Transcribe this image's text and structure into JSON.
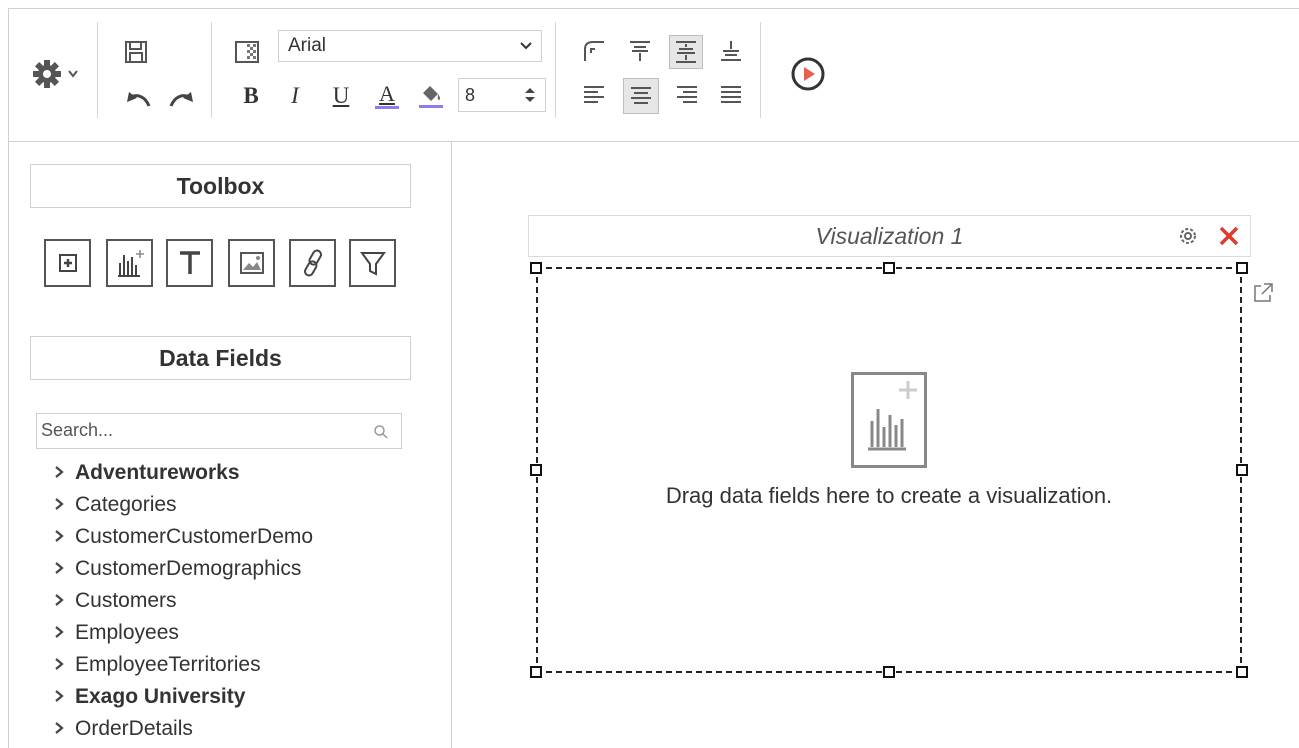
{
  "toolbar": {
    "settings_icon": "gear-dropdown-icon",
    "font_family": "Arial",
    "font_size": "8",
    "bold_label": "B",
    "italic_label": "I",
    "underline_label": "U",
    "font_color_label": "A",
    "font_color_accent": "#8a7ee8",
    "fill_color_accent": "#8a7ee8",
    "run_accent": "#e8604c"
  },
  "toolbox": {
    "title": "Toolbox",
    "tools": [
      "add-cell-icon",
      "chart-icon",
      "text-icon",
      "image-icon",
      "link-icon",
      "filter-icon"
    ]
  },
  "data_fields": {
    "title": "Data Fields",
    "search_placeholder": "Search...",
    "items": [
      {
        "label": "Adventureworks",
        "bold": true
      },
      {
        "label": "Categories",
        "bold": false
      },
      {
        "label": "CustomerCustomerDemo",
        "bold": false
      },
      {
        "label": "CustomerDemographics",
        "bold": false
      },
      {
        "label": "Customers",
        "bold": false
      },
      {
        "label": "Employees",
        "bold": false
      },
      {
        "label": "EmployeeTerritories",
        "bold": false
      },
      {
        "label": "Exago University",
        "bold": true
      },
      {
        "label": "OrderDetails",
        "bold": false
      }
    ]
  },
  "visualization": {
    "title": "Visualization 1",
    "hint": "Drag data fields here to create a visualization.",
    "close_color": "#e03a2e"
  }
}
